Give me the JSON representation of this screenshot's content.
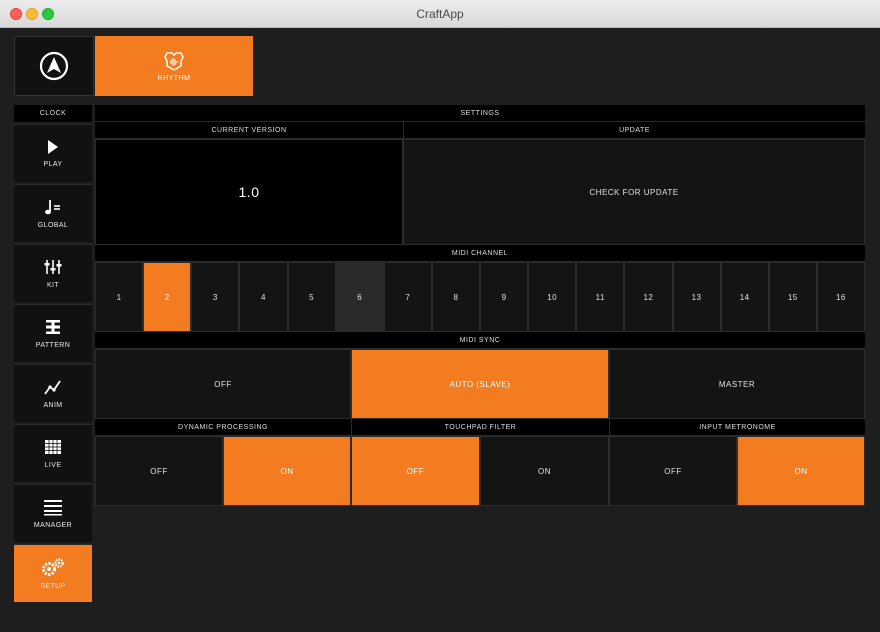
{
  "window": {
    "title": "CraftApp"
  },
  "top_tabs": [
    {
      "label": "RHYTHM",
      "icon": "rhythm-icon",
      "active": true
    }
  ],
  "sidebar": {
    "clock_label": "CLOCK",
    "items": [
      {
        "label": "PLAY",
        "icon": "play-icon"
      },
      {
        "label": "GLOBAL",
        "icon": "tempo-icon"
      },
      {
        "label": "KIT",
        "icon": "mixer-icon"
      },
      {
        "label": "PATTERN",
        "icon": "pattern-icon"
      },
      {
        "label": "ANIM",
        "icon": "anim-icon"
      },
      {
        "label": "LIVE",
        "icon": "grid-icon"
      },
      {
        "label": "MANAGER",
        "icon": "list-icon"
      },
      {
        "label": "SETUP",
        "icon": "gears-icon",
        "active": true
      }
    ]
  },
  "settings": {
    "title": "SETTINGS",
    "current_version_label": "CURRENT VERSION",
    "version": "1.0",
    "update_label": "UPDATE",
    "check_update": "CHECK FOR UPDATE",
    "midi_channel_label": "MIDI CHANNEL",
    "midi_channels": [
      "1",
      "2",
      "3",
      "4",
      "5",
      "6",
      "7",
      "8",
      "9",
      "10",
      "11",
      "12",
      "13",
      "14",
      "15",
      "16"
    ],
    "midi_channel_selected": "2",
    "midi_sync_label": "MIDI SYNC",
    "midi_sync_options": [
      "OFF",
      "AUTO (SLAVE)",
      "MASTER"
    ],
    "midi_sync_selected": "AUTO (SLAVE)",
    "dynamic_processing": {
      "label": "DYNAMIC PROCESSING",
      "off": "OFF",
      "on": "ON",
      "value": "ON"
    },
    "touchpad_filter": {
      "label": "TOUCHPAD FILTER",
      "off": "OFF",
      "on": "ON",
      "value": "OFF"
    },
    "input_metronome": {
      "label": "INPUT METRONOME",
      "off": "OFF",
      "on": "ON",
      "value": "ON"
    }
  },
  "colors": {
    "accent": "#f47c20",
    "background": "#1e1e1e",
    "panel": "#141414"
  }
}
